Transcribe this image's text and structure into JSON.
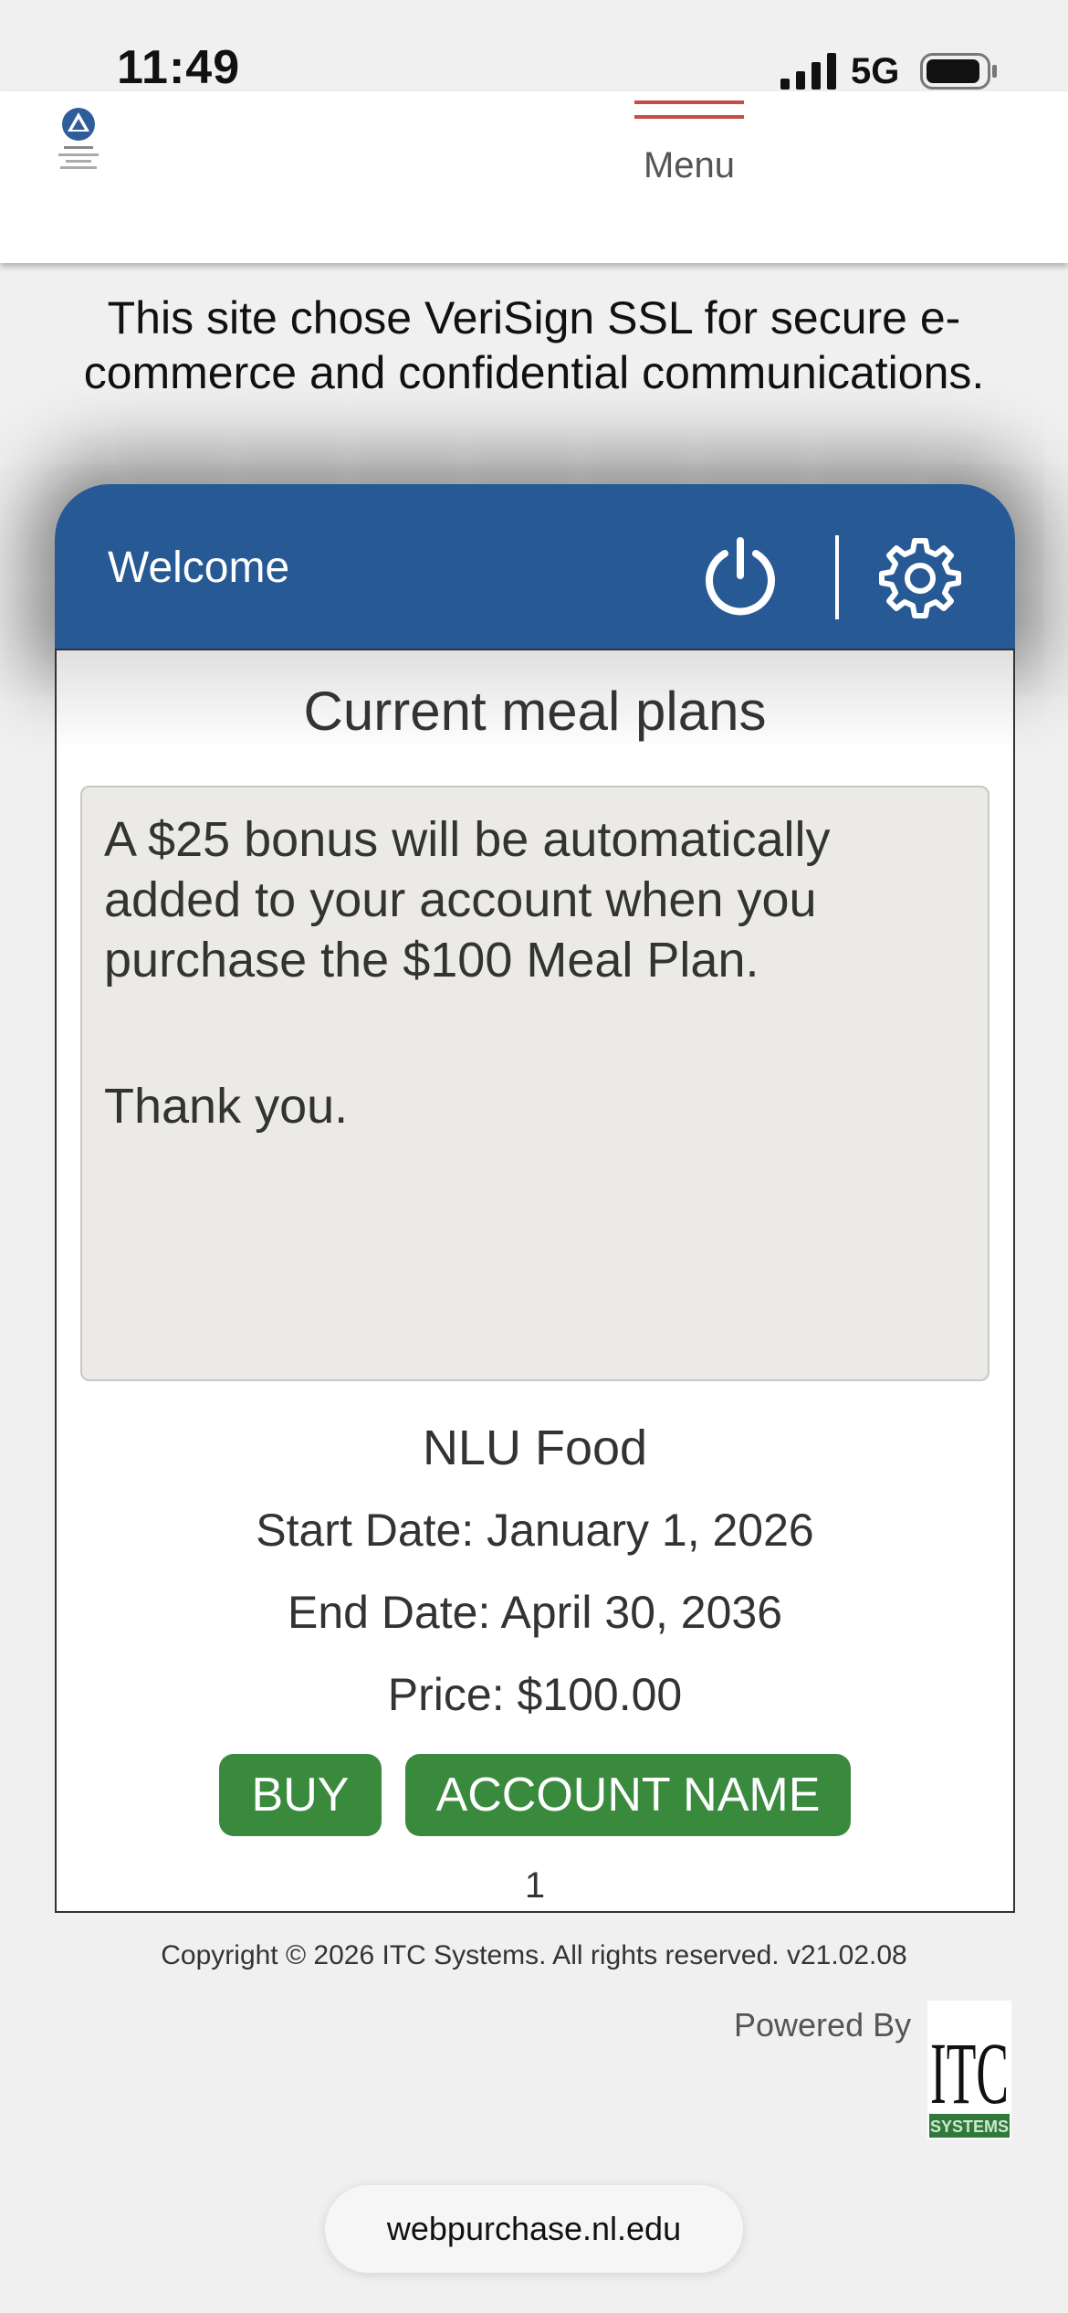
{
  "status_bar": {
    "time": "11:49",
    "network": "5G"
  },
  "header": {
    "logo_icon": "nlu-logo-icon",
    "menu_label": "Menu",
    "menu_icon_color": "#c94c41"
  },
  "ssl_note": "This site chose VeriSign SSL for secure e-commerce and confidential communications.",
  "card": {
    "welcome": "Welcome",
    "head_color": "#275a95",
    "power_icon": "power-icon",
    "settings_icon": "gear-icon",
    "title": "Current meal plans",
    "notice": {
      "line1": "A $25 bonus will be automatically added to your account when you purchase the $100 Meal Plan.",
      "line2": "Thank you."
    },
    "plan": {
      "name": "NLU Food",
      "start_date": "Start Date: January 1, 2026",
      "end_date": "End Date: April 30, 2036",
      "price": "Price: $100.00"
    },
    "buttons": {
      "buy": "BUY",
      "account_name": "ACCOUNT NAME",
      "color": "#3a8a3e"
    },
    "page_number": "1"
  },
  "footer": {
    "copyright": "Copyright © 2026 ITC Systems. All rights reserved. v21.02.08",
    "powered_by": "Powered By",
    "itc_logo_text": "ITC",
    "itc_logo_sub": "SYSTEMS"
  },
  "browser": {
    "url": "webpurchase.nl.edu"
  }
}
